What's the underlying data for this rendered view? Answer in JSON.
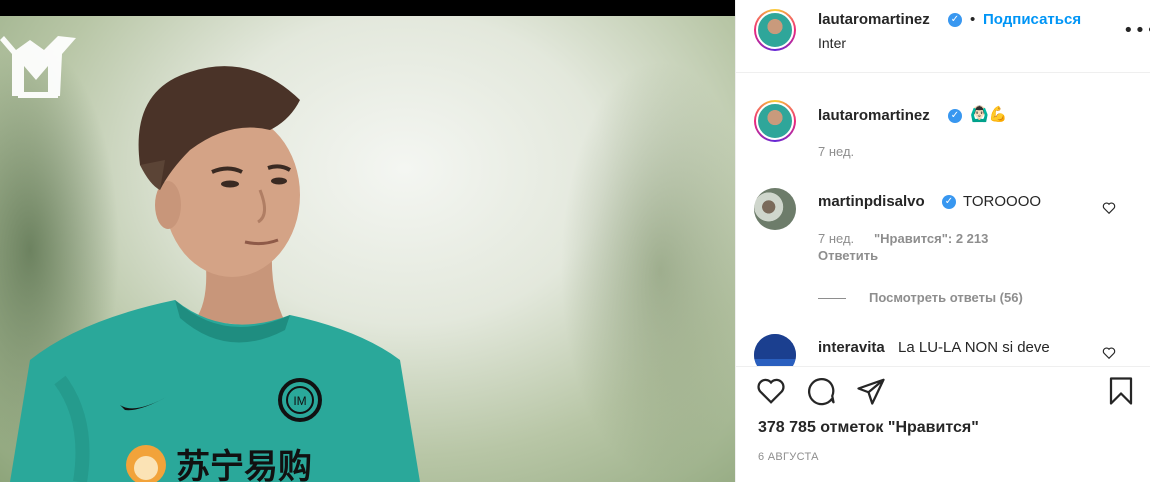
{
  "post": {
    "author": "lautaromartinez",
    "location": "Inter",
    "follow_label": "Подписаться",
    "caption_emoji": "🙆🏻‍♂️💪",
    "caption_age": "7 нед.",
    "likes_text": "378 785 отметок \"Нравится\"",
    "date_text": "6 АВГУСТА"
  },
  "photo": {
    "sponsor_text": "苏宁易购"
  },
  "comments": [
    {
      "user": "martinpdisalvo",
      "text": "TOROOOO",
      "age": "7 нед.",
      "likes": "\"Нравится\": 2 213",
      "reply_label": "Ответить",
      "view_replies": "Посмотреть ответы (56)"
    },
    {
      "user": "interavita",
      "text": "La LU-LA NON si deve"
    }
  ],
  "icons": {
    "verified": "✓",
    "more": "•••"
  },
  "colors": {
    "link_blue": "#0095f6",
    "verified_blue": "#3897f0",
    "muted_gray": "#8e8e8e",
    "jersey_teal": "#2aa89a"
  }
}
